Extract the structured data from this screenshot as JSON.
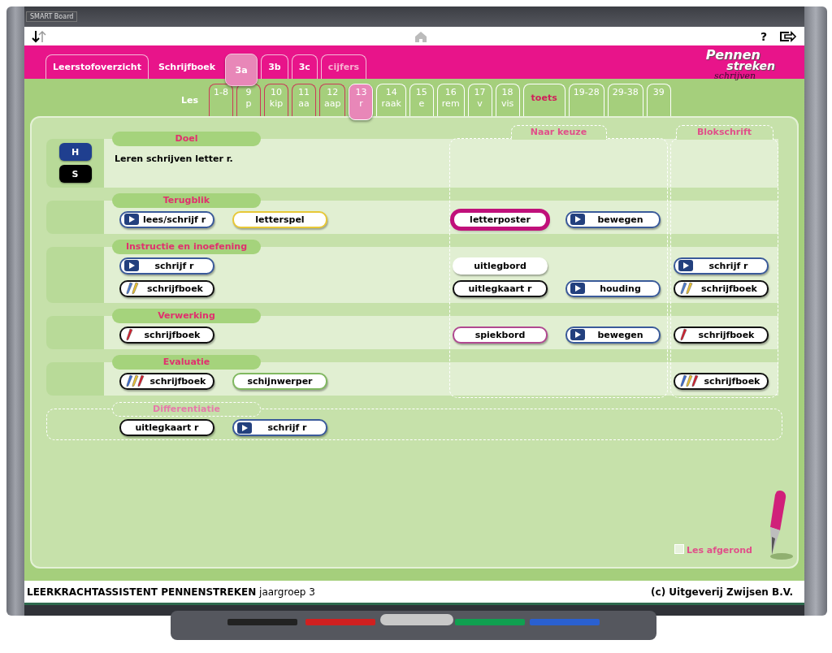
{
  "board": {
    "brand": "SMART Board"
  },
  "toolbar": {
    "help": "?"
  },
  "header": {
    "tabs": [
      {
        "label": "Leerstofoverzicht",
        "kind": "tab",
        "selected": false
      },
      {
        "label": "Schrijfboek",
        "kind": "plain",
        "selected": false
      },
      {
        "label": "3a",
        "kind": "tab",
        "selected": true
      },
      {
        "label": "3b",
        "kind": "tab",
        "selected": false
      },
      {
        "label": "3c",
        "kind": "tab",
        "selected": false
      },
      {
        "label": "cijfers",
        "kind": "extra",
        "selected": false
      }
    ],
    "logo": {
      "line_1": "Pennen",
      "line_2": "streken",
      "line_3": "schrijven"
    }
  },
  "lessons": {
    "label": "Les",
    "tabs": [
      {
        "kind": "lesson",
        "number": "1-8",
        "visited": true,
        "selected": false
      },
      {
        "kind": "lesson",
        "number": "9",
        "word": "p",
        "visited": true,
        "selected": false
      },
      {
        "kind": "lesson",
        "number": "10",
        "word": "kip",
        "visited": true,
        "selected": false
      },
      {
        "kind": "lesson",
        "number": "11",
        "word": "aa",
        "visited": true,
        "selected": false
      },
      {
        "kind": "lesson",
        "number": "12",
        "word": "aap",
        "visited": true,
        "selected": false
      },
      {
        "kind": "lesson",
        "number": "13",
        "word": "r",
        "visited": false,
        "selected": true
      },
      {
        "kind": "lesson",
        "number": "14",
        "word": "raak",
        "visited": false,
        "selected": false
      },
      {
        "kind": "lesson",
        "number": "15",
        "word": "e",
        "visited": false,
        "selected": false
      },
      {
        "kind": "lesson",
        "number": "16",
        "word": "rem",
        "visited": false,
        "selected": false
      },
      {
        "kind": "lesson",
        "number": "17",
        "word": "v",
        "visited": false,
        "selected": false
      },
      {
        "kind": "lesson",
        "number": "18",
        "word": "vis",
        "visited": false,
        "selected": false
      },
      {
        "kind": "test",
        "number": "toets",
        "visited": false,
        "selected": false
      },
      {
        "kind": "lesson",
        "number": "19-28",
        "visited": false,
        "selected": false
      },
      {
        "kind": "lesson",
        "number": "29-38",
        "visited": false,
        "selected": false
      },
      {
        "kind": "lesson",
        "number": "39",
        "visited": false,
        "selected": false
      }
    ]
  },
  "columns": {
    "choice": "Naar keuze",
    "block": "Blokschrift"
  },
  "sections": [
    {
      "title": "Doel",
      "toggles": [
        {
          "label": "H",
          "color": "#1f3f8f"
        },
        {
          "label": "S",
          "color": "#000000"
        }
      ],
      "text": "Leren schrijven letter r."
    },
    {
      "title": "Terugblik",
      "lines": [
        {
          "main": [
            {
              "label": "lees/schrijf r",
              "kind": "video",
              "color": "#3a5a9a",
              "highlighted": false
            },
            {
              "label": "letterspel",
              "kind": "plain",
              "color": "#e8c838",
              "highlighted": false
            }
          ],
          "choice": [
            {
              "label": "letterposter",
              "kind": "plain",
              "color": "#c0107a",
              "highlighted": true
            },
            {
              "label": "bewegen",
              "kind": "video",
              "color": "#3a5a9a",
              "highlighted": false
            }
          ]
        }
      ]
    },
    {
      "title": "Instructie en inoefening",
      "lines": [
        {
          "main": [
            {
              "label": "schrijf r",
              "kind": "video",
              "color": "#3a5a9a",
              "highlighted": false
            }
          ],
          "choice": [
            {
              "label": "uitlegbord",
              "kind": "plain",
              "color": "#ffffff",
              "highlighted": false
            }
          ],
          "block": [
            {
              "label": "schrijf r",
              "kind": "video",
              "color": "#3a5a9a",
              "highlighted": false
            }
          ]
        },
        {
          "main": [
            {
              "label": "schrijfboek",
              "kind": "duopen",
              "color": "#111111",
              "highlighted": false
            }
          ],
          "choice": [
            {
              "label": "uitlegkaart r",
              "kind": "plain",
              "color": "#111111",
              "highlighted": false
            },
            {
              "label": "houding",
              "kind": "video",
              "color": "#3a5a9a",
              "highlighted": false
            }
          ],
          "block": [
            {
              "label": "schrijfboek",
              "kind": "duopen",
              "color": "#111111",
              "highlighted": false
            }
          ]
        }
      ]
    },
    {
      "title": "Verwerking",
      "lines": [
        {
          "main": [
            {
              "label": "schrijfboek",
              "kind": "redpen",
              "color": "#111111",
              "highlighted": false
            }
          ],
          "choice": [
            {
              "label": "spiekbord",
              "kind": "plain",
              "color": "#b04890",
              "highlighted": false
            },
            {
              "label": "bewegen",
              "kind": "video",
              "color": "#3a5a9a",
              "highlighted": false
            }
          ],
          "block": [
            {
              "label": "schrijfboek",
              "kind": "redpen",
              "color": "#111111",
              "highlighted": false
            }
          ]
        }
      ]
    },
    {
      "title": "Evaluatie",
      "lines": [
        {
          "main": [
            {
              "label": "schrijfboek",
              "kind": "triopen",
              "color": "#111111",
              "highlighted": false
            },
            {
              "label": "schijnwerper",
              "kind": "plain",
              "color": "#80b860",
              "highlighted": false
            }
          ],
          "block": [
            {
              "label": "schrijfboek",
              "kind": "triopen",
              "color": "#111111",
              "highlighted": false
            }
          ]
        }
      ]
    }
  ],
  "differentiation": {
    "title": "Differentiatie",
    "buttons": [
      {
        "label": "uitlegkaart r",
        "kind": "plain",
        "color": "#111111",
        "highlighted": false
      },
      {
        "label": "schrijf r",
        "kind": "video",
        "color": "#3a5a9a",
        "highlighted": false
      }
    ]
  },
  "completion": {
    "label": "Les afgerond",
    "checked": false
  },
  "footer": {
    "left": "**LEERKRACHTASSISTENT PENNENSTREKEN** jaargroep 3",
    "right": "(c) Uitgeverij Zwijsen B.V."
  }
}
